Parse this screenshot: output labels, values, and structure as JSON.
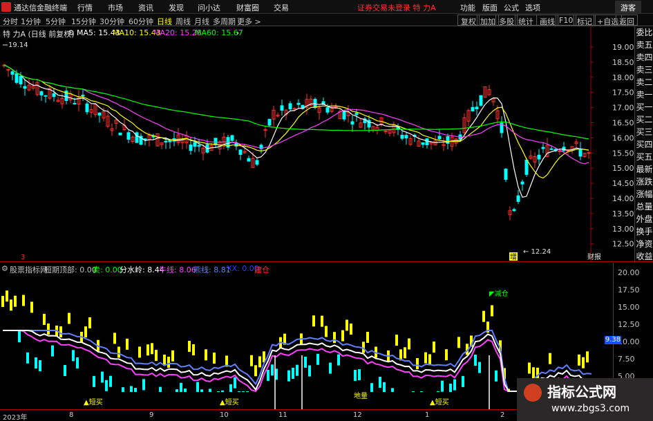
{
  "menu": {
    "app_title": "通达信金融终端",
    "items": [
      "行情",
      "市场",
      "资讯",
      "发现",
      "问小达",
      "财富圈",
      "交易"
    ],
    "alert": "证券交易未登录  特 力A",
    "right_items": [
      "功能",
      "版面",
      "公式",
      "选项"
    ],
    "guest": "游客"
  },
  "periods": [
    "分时",
    "1分钟",
    "5分钟",
    "15分钟",
    "30分钟",
    "60分钟",
    "日线",
    "周线",
    "月线",
    "多周期",
    "更多 >"
  ],
  "active_period": "日线",
  "toolbar": [
    "复权",
    "加加",
    "多股",
    "统计",
    "画线",
    "F10",
    "标记",
    "+自选",
    "返回"
  ],
  "sidebar": [
    "委比",
    "卖五",
    "卖四",
    "卖三",
    "卖二",
    "卖一",
    "买一",
    "买二",
    "买三",
    "买四",
    "买五",
    "最新",
    "涨跌",
    "涨幅",
    "总量",
    "外盘",
    "换手",
    "净资",
    "收益"
  ],
  "main_chart": {
    "title": "特 力A (日线 前复权)",
    "ma": [
      {
        "label": "MA5: 15.43",
        "color": "#ffffff"
      },
      {
        "label": "MA10: 15.43",
        "color": "#ffff00"
      },
      {
        "label": "MA20: 15.28",
        "color": "#ff40ff"
      },
      {
        "label": "MA60: 15.67",
        "color": "#00ff00"
      }
    ],
    "price_ticks": [
      "19.00",
      "18.50",
      "18.00",
      "17.50",
      "17.00",
      "16.50",
      "16.00",
      "15.50",
      "15.00",
      "14.50",
      "14.00",
      "13.50",
      "13.00",
      "12.50"
    ],
    "high_label": "19.14",
    "low_label": "12.24",
    "badge_left": "3",
    "badge_low": "增",
    "badge_report": "财报",
    "colors": {
      "up": "#ff3030",
      "down": "#00ffff",
      "ma5": "#ffffff",
      "ma10": "#ffff00",
      "ma20": "#ff40ff",
      "ma60": "#00ff00"
    }
  },
  "indicator": {
    "items": [
      {
        "label": "股票指标网",
        "color": "#c0c0c0"
      },
      {
        "label": "短期顶部: 0.00",
        "color": "#c0c0c0"
      },
      {
        "label": "卖: 0.00",
        "color": "#00ff00"
      },
      {
        "label": "分水岭: 8.44",
        "color": "#ffffff"
      },
      {
        "label": "牛线: 8.06",
        "color": "#ff40ff"
      },
      {
        "label": "熊线: 8.81",
        "color": "#6080ff"
      },
      {
        "label": "XX: 0.00",
        "color": "#2040ff"
      },
      {
        "label": "建仓",
        "color": "#ff3030"
      }
    ],
    "ticks": [
      "20.00",
      "17.50",
      "15.00",
      "12.50",
      "10.00",
      "7.50",
      "5.00"
    ],
    "current_value": "9.38",
    "annotations": {
      "jiancang": "减仓",
      "dilian": "地量",
      "buy": "短买"
    }
  },
  "dates": [
    "2023年",
    "8",
    "9",
    "10",
    "11",
    "12",
    "1",
    "2"
  ],
  "watermark": {
    "title": "指标公式网",
    "url": "www.zbgs3.com"
  },
  "chart_data": {
    "type": "candlestick",
    "y_range": [
      12.24,
      19.14
    ],
    "high": 19.14,
    "low": 12.24
  }
}
